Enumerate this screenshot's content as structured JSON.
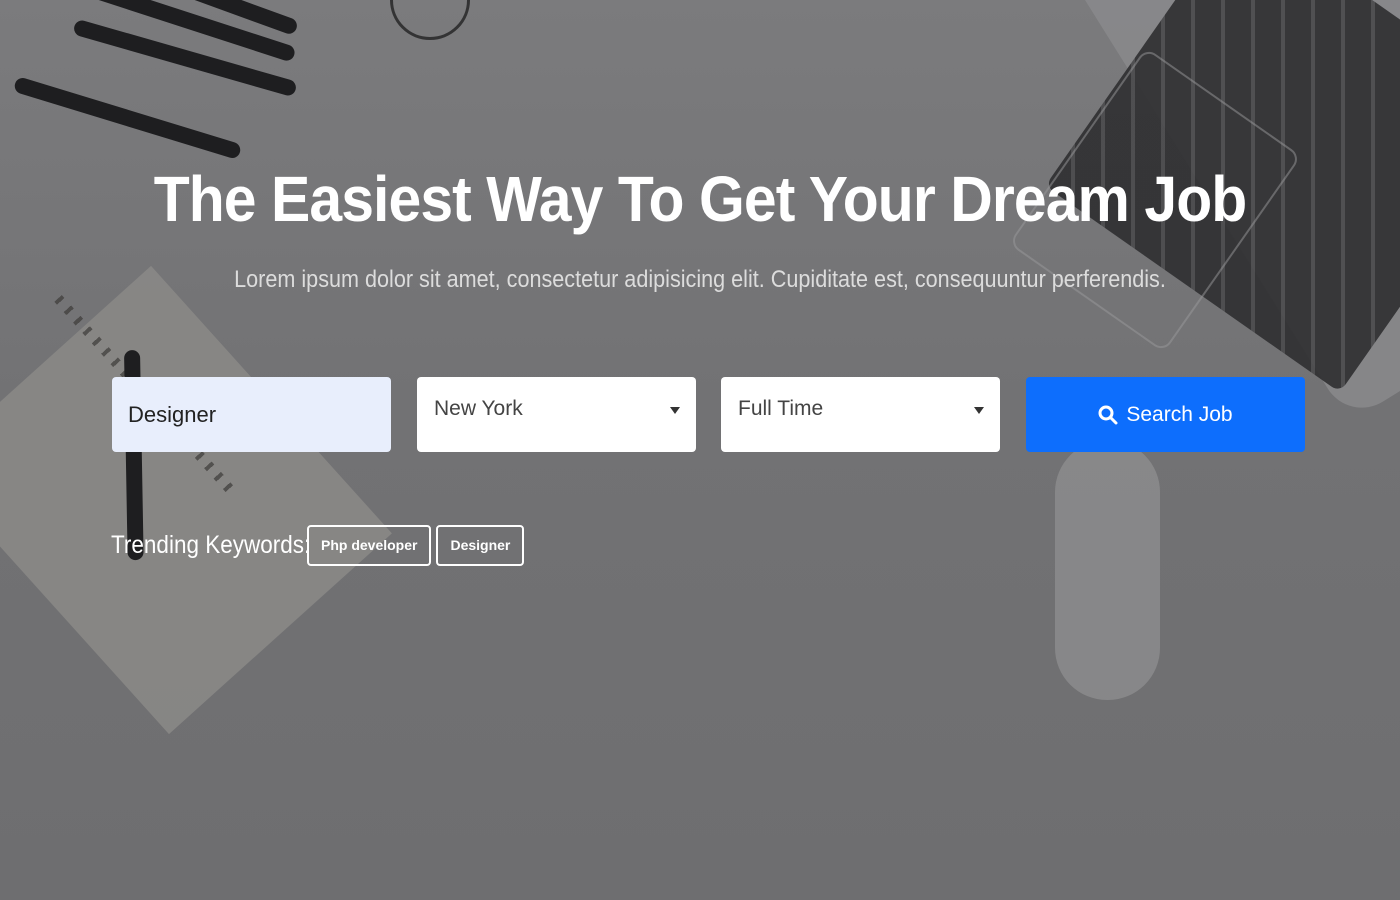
{
  "hero": {
    "title": "The Easiest Way To Get Your Dream Job",
    "subtitle": "Lorem ipsum dolor sit amet, consectetur adipisicing elit. Cupiditate est, consequuntur perferendis."
  },
  "search": {
    "keyword_value": "Designer",
    "location_value": "New York",
    "job_type_value": "Full Time",
    "button_label": "Search Job",
    "button_icon": "search-icon"
  },
  "trending": {
    "label": "Trending Keywords:",
    "tags": [
      "Php developer",
      "Designer"
    ]
  },
  "colors": {
    "accent": "#0d6efd",
    "overlay": "#6f6f71",
    "input_bg": "#e8eefc"
  }
}
